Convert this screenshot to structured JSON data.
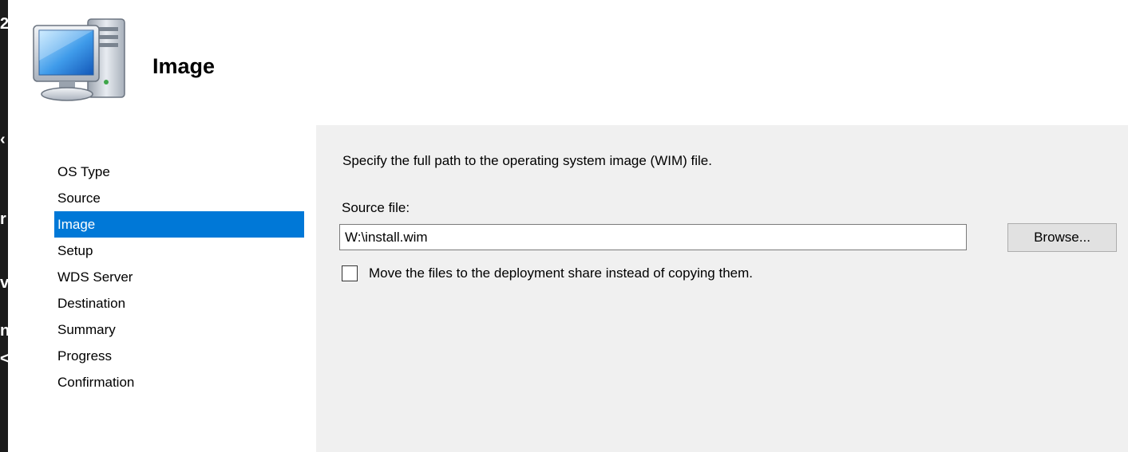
{
  "window": {
    "edge_chars": [
      "2",
      "‹",
      "r",
      "v",
      "n",
      "<"
    ]
  },
  "header": {
    "title": "Image",
    "icon": "computer-icon"
  },
  "nav": {
    "items": [
      {
        "label": "OS Type",
        "selected": false
      },
      {
        "label": "Source",
        "selected": false
      },
      {
        "label": "Image",
        "selected": true
      },
      {
        "label": "Setup",
        "selected": false
      },
      {
        "label": "WDS Server",
        "selected": false
      },
      {
        "label": "Destination",
        "selected": false
      },
      {
        "label": "Summary",
        "selected": false
      },
      {
        "label": "Progress",
        "selected": false
      },
      {
        "label": "Confirmation",
        "selected": false
      }
    ]
  },
  "content": {
    "instruction": "Specify the full path to the operating system image (WIM) file.",
    "source_label": "Source file:",
    "source_value": "W:\\install.wim",
    "browse_label": "Browse...",
    "move_label": "Move the files to the deployment share instead of copying them.",
    "move_checked": false
  },
  "colors": {
    "selection": "#0078d7",
    "content_bg": "#f0f0f0",
    "edge": "#1b1b1b"
  }
}
